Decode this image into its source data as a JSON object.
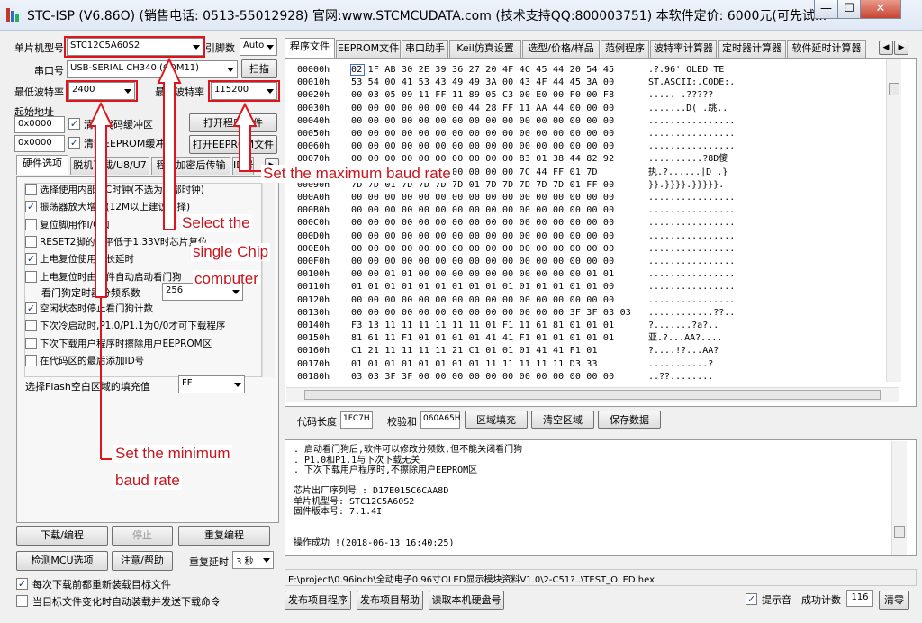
{
  "window": {
    "title": "STC-ISP (V6.86O) (销售电话: 0513-55012928) 官网:www.STCMCUDATA.com  (技术支持QQ:800003751) 本软件定价: 6000元(可先试...",
    "min_glyph": "—",
    "max_glyph": "☐",
    "close_glyph": "✕"
  },
  "left": {
    "mcu_label": "单片机型号",
    "mcu_value": "STC12C5A60S2",
    "pins_label": "引脚数",
    "pins_value": "Auto",
    "port_label": "串口号",
    "port_value": "USB-SERIAL CH340 (COM11)",
    "scan_button": "扫描",
    "min_baud_label": "最低波特率",
    "min_baud_value": "2400",
    "max_baud_label": "最高波特率",
    "max_baud_value": "115200",
    "start_addr_label": "起始地址",
    "addr1": "0x0000",
    "clear_code_label": "清除代码缓冲区",
    "open_prog_button": "打开程序文件",
    "addr2": "0x0000",
    "clear_eeprom_label": "清除EEPROM缓冲区",
    "open_eeprom_button": "打开EEPROM文件",
    "tabs": [
      "硬件选项",
      "脱机下载/U8/U7",
      "程序加密后传输",
      "ID号"
    ],
    "options": [
      {
        "label": "选择使用内部IRC时钟(不选为外部时钟)",
        "checked": false
      },
      {
        "label": "振荡器放大增益(12M以上建议选择)",
        "checked": true
      },
      {
        "label": "复位脚用作I/O口",
        "checked": false
      },
      {
        "label": "RESET2脚的电平低于1.33V时芯片复位",
        "checked": false
      },
      {
        "label": "上电复位使用较长延时",
        "checked": true
      },
      {
        "label": "上电复位时由硬件自动启动看门狗",
        "checked": false
      }
    ],
    "watchdog_label": "看门狗定时器分频系数",
    "watchdog_value": "256",
    "options2": [
      {
        "label": "空闲状态时停止看门狗计数",
        "checked": true
      },
      {
        "label": "下次冷启动时,P1.0/P1.1为0/0才可下载程序",
        "checked": false
      },
      {
        "label": "下次下载用户程序时擦除用户EEPROM区",
        "checked": false
      },
      {
        "label": "在代码区的最后添加ID号",
        "checked": false
      }
    ],
    "fill_label": "选择Flash空白区域的填充值",
    "fill_value": "FF",
    "download_button": "下载/编程",
    "stop_button": "停止",
    "reprogram_button": "重复编程",
    "detect_button": "检测MCU选项",
    "help_button": "注意/帮助",
    "repeat_delay_label": "重复延时",
    "repeat_delay_value": "3 秒",
    "reload_label": "每次下载前都重新装载目标文件",
    "auto_label": "当目标文件变化时自动装载并发送下载命令"
  },
  "right": {
    "tabs": [
      "程序文件",
      "EEPROM文件",
      "串口助手",
      "Keil仿真设置",
      "选型/价格/样品",
      "范例程序",
      "波特率计算器",
      "定时器计算器",
      "软件延时计算器"
    ],
    "hex_rows": [
      {
        "addr": "00000h",
        "bytes": "02 1F AB 30 2E 39 36 27 20 4F 4C 45 44 20 54 45",
        "ascii": ".?.96' OLED TE"
      },
      {
        "addr": "00010h",
        "bytes": "53 54 00 41 53 43 49 49 3A 00 43 4F 44 45 3A 00",
        "ascii": "ST.ASCII:.CODE:."
      },
      {
        "addr": "00020h",
        "bytes": "00 03 05 09 11 FF 11 89 05 C3 00 E0 00 F0 00 F8",
        "ascii": ".....  .?????"
      },
      {
        "addr": "00030h",
        "bytes": "00 00 00 00 00 00 00 44 28 FF 11 AA 44 00 00 00",
        "ascii": ".......D(  .跳.."
      },
      {
        "addr": "00040h",
        "bytes": "00 00 00 00 00 00 00 00 00 00 00 00 00 00 00 00",
        "ascii": "................"
      },
      {
        "addr": "00050h",
        "bytes": "00 00 00 00 00 00 00 00 00 00 00 00 00 00 00 00",
        "ascii": "................"
      },
      {
        "addr": "00060h",
        "bytes": "00 00 00 00 00 00 00 00 00 00 00 00 00 00 00 00",
        "ascii": "................"
      },
      {
        "addr": "00070h",
        "bytes": "00 00 00 00 00 00 00 00 00 00 83 01 38 44 82 92",
        "ascii": "..........?8D傻"
      },
      {
        "addr": "00080h",
        "bytes": "AA 00 00 00 00 00 00 00 00 00 7C 44 FF 01 7D",
        "ascii": "执.?......|D  .}"
      },
      {
        "addr": "00090h",
        "bytes": "7D 7D 01 7D 7D 7D 7D 01 7D 7D 7D 7D 7D 01 FF 00",
        "ascii": "}}.}}}}.}}}}}."
      },
      {
        "addr": "000A0h",
        "bytes": "00 00 00 00 00 00 00 00 00 00 00 00 00 00 00 00",
        "ascii": "................"
      },
      {
        "addr": "000B0h",
        "bytes": "00 00 00 00 00 00 00 00 00 00 00 00 00 00 00 00",
        "ascii": "................"
      },
      {
        "addr": "000C0h",
        "bytes": "00 00 00 00 00 00 00 00 00 00 00 00 00 00 00 00",
        "ascii": "................"
      },
      {
        "addr": "000D0h",
        "bytes": "00 00 00 00 00 00 00 00 00 00 00 00 00 00 00 00",
        "ascii": "................"
      },
      {
        "addr": "000E0h",
        "bytes": "00 00 00 00 00 00 00 00 00 00 00 00 00 00 00 00",
        "ascii": "................"
      },
      {
        "addr": "000F0h",
        "bytes": "00 00 00 00 00 00 00 00 00 00 00 00 00 00 00 00",
        "ascii": "................"
      },
      {
        "addr": "00100h",
        "bytes": "00 00 01 01 00 00 00 00 00 00 00 00 00 00 01 01",
        "ascii": "................"
      },
      {
        "addr": "00110h",
        "bytes": "01 01 01 01 01 01 01 01 01 01 01 01 01 01 01 00",
        "ascii": "................"
      },
      {
        "addr": "00120h",
        "bytes": "00 00 00 00 00 00 00 00 00 00 00 00 00 00 00 00",
        "ascii": "................"
      },
      {
        "addr": "00130h",
        "bytes": "00 00 00 00 00 00 00 00 00 00 00 00 00 3F 3F 03 03",
        "ascii": "............??.."
      },
      {
        "addr": "00140h",
        "bytes": "F3 13 11 11 11 11 11 11 01 F1 11 61 81 01 01 01",
        "ascii": "?.......?a?.."
      },
      {
        "addr": "00150h",
        "bytes": "81 61 11 F1 01 01 01 01 41 41 F1 01 01 01 01 01",
        "ascii": "亚.?...AA?...."
      },
      {
        "addr": "00160h",
        "bytes": "C1 21 11 11 11 11 21 C1 01 01 01 41 41 F1 01",
        "ascii": "?....!?...AA?"
      },
      {
        "addr": "00170h",
        "bytes": "01 01 01 01 01 01 01 01 11 11 11 11 11 D3 33",
        "ascii": "...........?"
      },
      {
        "addr": "00180h",
        "bytes": "03 03 3F 3F 00 00 00 00 00 00 00 00 00 00 00 00",
        "ascii": "..??........"
      }
    ],
    "code_len_label": "代码长度",
    "code_len_value": "1FC7H",
    "checksum_label": "校验和",
    "checksum_value": "060A65H",
    "fill_region_button": "区域填充",
    "clear_region_button": "清空区域",
    "save_data_button": "保存数据",
    "log": [
      ". 启动看门狗后,软件可以修改分频数,但不能关闭看门狗",
      ". P1.0和P1.1与下次下载无关",
      ". 下次下载用户程序时,不擦除用户EEPROM区",
      "",
      "  芯片出厂序列号 : D17E015C6CAA8D",
      "单片机型号: STC12C5A60S2",
      "固件版本号: 7.1.4I",
      "",
      "",
      "操作成功 !(2018-06-13 16:40:25)"
    ],
    "path": "E:\\project\\0.96inch\\全动电子0.96寸OLED显示模块资料V1.0\\2-C51?..\\TEST_OLED.hex",
    "publish_button": "发布项目程序",
    "publish_help_button": "发布项目帮助",
    "read_disk_button": "读取本机硬盘号",
    "beep_label": "提示音",
    "success_count_label": "成功计数",
    "success_count_value": "116",
    "clear_button": "清零"
  },
  "annotations": {
    "max_baud": "Set the maximum baud rate",
    "select_chip_1": "Select the",
    "select_chip_2": "single Chip",
    "select_chip_3": "computer",
    "min_baud_1": "Set the minimum",
    "min_baud_2": "baud rate"
  }
}
